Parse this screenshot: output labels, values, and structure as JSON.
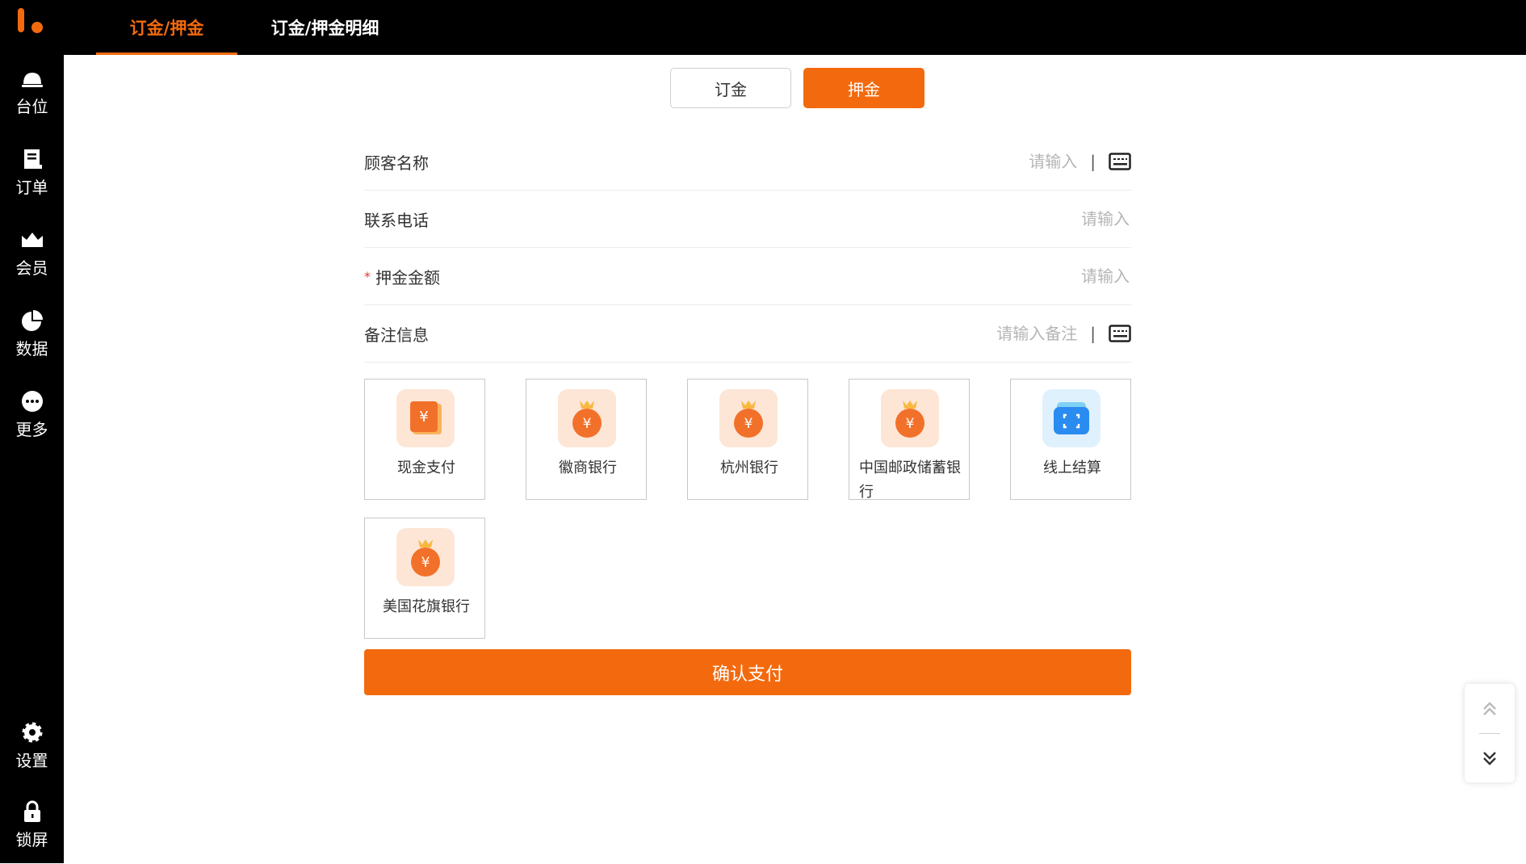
{
  "sidebar": {
    "items": [
      {
        "label": "台位",
        "icon": "bell-icon"
      },
      {
        "label": "订单",
        "icon": "order-icon"
      },
      {
        "label": "会员",
        "icon": "crown-icon"
      },
      {
        "label": "数据",
        "icon": "pie-chart-icon"
      },
      {
        "label": "更多",
        "icon": "more-icon"
      },
      {
        "label": "设置",
        "icon": "gear-icon"
      },
      {
        "label": "锁屏",
        "icon": "lock-icon"
      }
    ]
  },
  "tabs": [
    {
      "label": "订金/押金",
      "active": true
    },
    {
      "label": "订金/押金明细",
      "active": false
    }
  ],
  "segments": [
    {
      "label": "订金",
      "selected": false
    },
    {
      "label": "押金",
      "selected": true
    }
  ],
  "form": {
    "customer_name": {
      "label": "顾客名称",
      "placeholder": "请输入",
      "separator": "|"
    },
    "phone": {
      "label": "联系电话",
      "placeholder": "请输入"
    },
    "deposit_amount": {
      "label": "押金金额",
      "required_mark": "*",
      "placeholder": "请输入"
    },
    "remark": {
      "label": "备注信息",
      "placeholder": "请输入备注",
      "separator": "|"
    }
  },
  "payments": [
    {
      "label": "现金支付",
      "icon": "cash-icon"
    },
    {
      "label": "徽商银行",
      "icon": "money-bag-icon"
    },
    {
      "label": "杭州银行",
      "icon": "money-bag-icon"
    },
    {
      "label": "中国邮政储蓄银行",
      "icon": "money-bag-icon"
    },
    {
      "label": "线上结算",
      "icon": "scan-wallet-icon"
    },
    {
      "label": "美国花旗银行",
      "icon": "money-bag-icon"
    }
  ],
  "confirm_label": "确认支付",
  "colors": {
    "accent": "#f36a0e",
    "sidebar_bg": "#000000",
    "placeholder": "#b5b5b5"
  }
}
